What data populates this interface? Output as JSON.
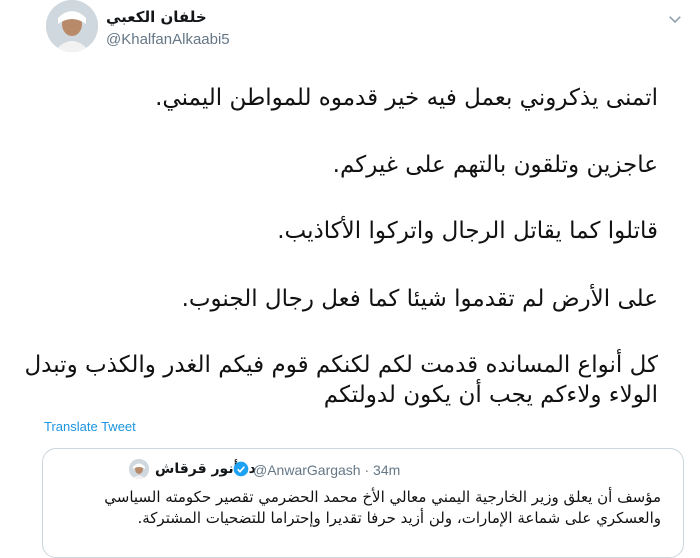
{
  "tweet": {
    "display_name": "خلفان الكعبي",
    "handle": "@KhalfanAlkaabi5",
    "lines": [
      "اتمنى يذكروني بعمل فيه خير قدموه للمواطن اليمني.",
      "عاجزين وتلقون بالتهم على غيركم.",
      "قاتلوا كما يقاتل الرجال واتركوا الأكاذيب.",
      "على الأرض لم تقدموا شيئا كما فعل رجال الجنوب.",
      "كل أنواع المسانده قدمت لكم لكنكم قوم فيكم الغدر والكذب وتبدل الولاء    ولاءكم يجب أن يكون لدولتكم"
    ],
    "translate_label": "Translate Tweet"
  },
  "quoted": {
    "display_name": "د. أنور قرقاش",
    "handle_meta": "@AnwarGargash · 34m",
    "text": "مؤسف أن يعلق وزير الخارجية اليمني معالي الأخ محمد الحضرمي تقصير حكومته السياسي والعسكري على شماعة الإمارات، ولن أزيد حرفا تقديرا وإحتراما للتضحيات المشتركة."
  },
  "icons": {
    "menu": "chevron-down-icon",
    "verified": "verified-badge-icon"
  },
  "colors": {
    "link": "#1b95e0",
    "secondary_text": "#657786",
    "border": "#ccd6dd"
  }
}
